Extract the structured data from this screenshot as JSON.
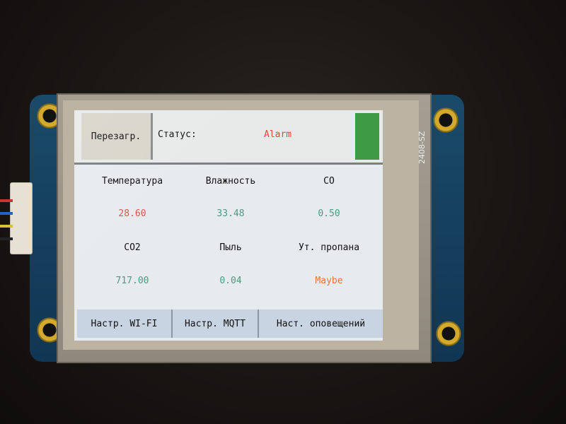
{
  "device": {
    "board_label": "2408-SZ"
  },
  "header": {
    "reboot_button": "Перезагр.",
    "status_label": "Статус:",
    "status_value": "Alarm",
    "status_led_color": "#3f9a45"
  },
  "sensors": [
    {
      "label": "Температура",
      "value": "28.60",
      "color": "#d9544f"
    },
    {
      "label": "Влажность",
      "value": "33.48",
      "color": "#4d9a7e"
    },
    {
      "label": "CO",
      "value": "0.50",
      "color": "#4d9a7e"
    },
    {
      "label": "CO2",
      "value": "717.00",
      "color": "#4d9a7e"
    },
    {
      "label": "Пыль",
      "value": "0.04",
      "color": "#4d9a7e"
    },
    {
      "label": "Ут. пропана",
      "value": "Maybe",
      "color": "#f0723d"
    }
  ],
  "footer": {
    "wifi_button": "Настр. WI-FI",
    "mqtt_button": "Настр. MQTT",
    "alerts_button": "Наст. оповещений"
  },
  "colors": {
    "alarm": "#e5483a",
    "normal_value": "#4d9a7e",
    "temp_value": "#d9544f",
    "warning_value": "#f0723d",
    "button_bg": "#c9d4e3"
  }
}
